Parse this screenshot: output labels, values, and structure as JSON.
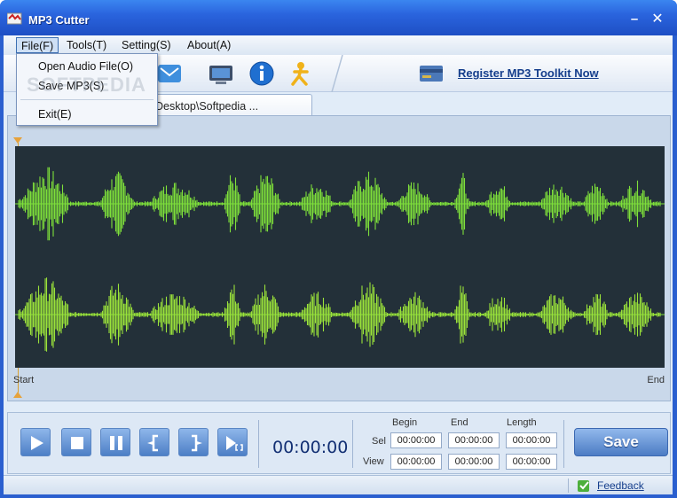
{
  "window": {
    "title": "MP3 Cutter"
  },
  "menu": {
    "file": "File(F)",
    "tools": "Tools(T)",
    "setting": "Setting(S)",
    "about": "About(A)",
    "file_items": [
      "Open Audio File(O)",
      "Save MP3(S)",
      "Exit(E)"
    ]
  },
  "toolbar": {
    "icons": [
      "mail-icon",
      "monitor-icon",
      "info-icon",
      "aim-icon"
    ],
    "register_label": "Register MP3 Toolkit Now"
  },
  "tab": {
    "label": "Desktop\\Softpedia ..."
  },
  "wave": {
    "start_label": "Start",
    "end_label": "End",
    "wave_color": "#7ee03a",
    "background": "#233039"
  },
  "watermark": "SOFTPEDIA",
  "controls": {
    "time": "00:00:00",
    "columns": [
      "Begin",
      "End",
      "Length"
    ],
    "rows": [
      {
        "label": "Sel",
        "begin": "00:00:00",
        "end": "00:00:00",
        "length": "00:00:00"
      },
      {
        "label": "View",
        "begin": "00:00:00",
        "end": "00:00:00",
        "length": "00:00:00"
      }
    ],
    "save_label": "Save"
  },
  "status": {
    "feedback_label": "Feedback"
  }
}
